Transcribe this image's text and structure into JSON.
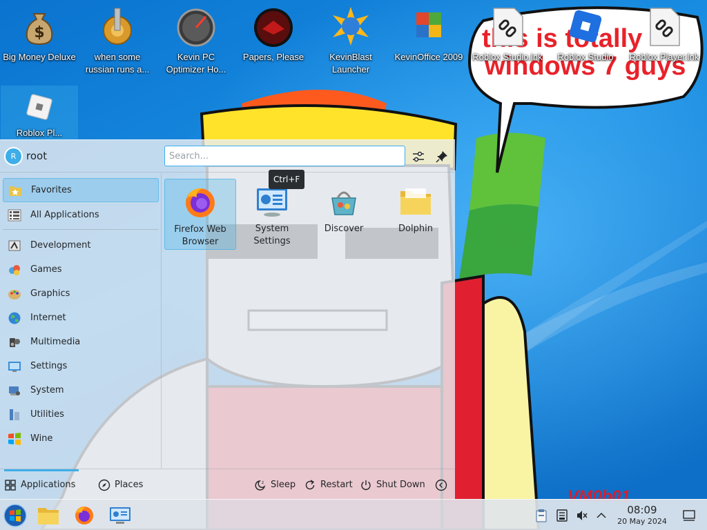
{
  "desktop": {
    "icons": [
      {
        "label": "Big Money Deluxe",
        "icon": "money-bag-icon"
      },
      {
        "label": "when some russian runs a...",
        "icon": "gear-coin-icon"
      },
      {
        "label": "Kevin PC Optimizer Ho...",
        "icon": "speedometer-icon"
      },
      {
        "label": "Papers, Please",
        "icon": "papers-please-icon"
      },
      {
        "label": "KevinBlast Launcher",
        "icon": "kevinblast-icon"
      },
      {
        "label": "KevinOffice 2009",
        "icon": "office-icon"
      },
      {
        "label": "Roblox Studio.lnk",
        "icon": "link-file-icon"
      },
      {
        "label": "Roblox Studio",
        "icon": "roblox-studio-icon"
      },
      {
        "label": "Roblox Player.lnk",
        "icon": "link-file-icon"
      },
      {
        "label": "Roblox Pl...",
        "icon": "roblox-icon"
      }
    ]
  },
  "wallpaper": {
    "speech_bubble_text": [
      "this is totally",
      "windows 7 guys"
    ],
    "signature": "VM0b01"
  },
  "start_menu": {
    "user": {
      "initial": "R",
      "name": "root"
    },
    "search": {
      "placeholder": "Search...",
      "value": ""
    },
    "tooltip": "Ctrl+F",
    "categories": [
      {
        "label": "Favorites",
        "icon": "star-folder-icon",
        "active": true
      },
      {
        "label": "All Applications",
        "icon": "grid-list-icon",
        "active": false
      },
      {
        "label": "Development",
        "icon": "development-icon",
        "active": false
      },
      {
        "label": "Games",
        "icon": "games-icon",
        "active": false
      },
      {
        "label": "Graphics",
        "icon": "graphics-icon",
        "active": false
      },
      {
        "label": "Internet",
        "icon": "internet-globe-icon",
        "active": false
      },
      {
        "label": "Multimedia",
        "icon": "multimedia-icon",
        "active": false
      },
      {
        "label": "Settings",
        "icon": "settings-icon",
        "active": false
      },
      {
        "label": "System",
        "icon": "system-icon",
        "active": false
      },
      {
        "label": "Utilities",
        "icon": "utilities-icon",
        "active": false
      },
      {
        "label": "Wine",
        "icon": "wine-windows-icon",
        "active": false
      }
    ],
    "favorites": [
      {
        "label": "Firefox Web Browser",
        "icon": "firefox-icon",
        "active": true
      },
      {
        "label": "System Settings",
        "icon": "system-settings-icon",
        "active": false
      },
      {
        "label": "Discover",
        "icon": "discover-icon",
        "active": false
      },
      {
        "label": "Dolphin",
        "icon": "dolphin-folder-icon",
        "active": false
      }
    ],
    "footer": {
      "tabs": [
        {
          "label": "Applications",
          "icon": "grid-icon",
          "active": true
        },
        {
          "label": "Places",
          "icon": "compass-icon",
          "active": false
        }
      ],
      "actions": [
        {
          "label": "Sleep",
          "icon": "sleep-icon"
        },
        {
          "label": "Restart",
          "icon": "restart-icon"
        },
        {
          "label": "Shut Down",
          "icon": "power-icon"
        }
      ]
    }
  },
  "taskbar": {
    "pinned": [
      "start-orb-icon",
      "file-manager-icon",
      "firefox-icon",
      "system-settings-icon"
    ],
    "tray": [
      "clipboard-icon",
      "storage-icon",
      "volume-muted-icon",
      "chevron-up-icon"
    ],
    "clock": {
      "time": "08:09",
      "date": "20 May 2024"
    }
  },
  "colors": {
    "accent": "#3daee9",
    "wallpaper_blue": "#1d8fe0",
    "bubble_text": "#e8222a"
  }
}
